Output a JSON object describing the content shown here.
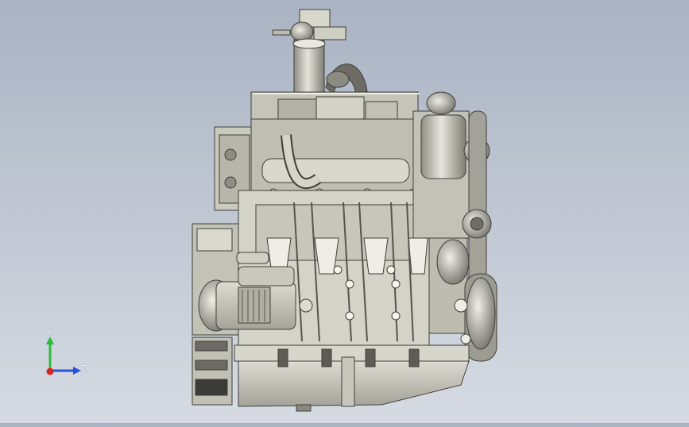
{
  "window": {
    "title": ""
  },
  "viewport": {
    "background_top": "#a9b3c3",
    "background_bottom": "#d6dbe3",
    "model": "engine-assembly-side-view",
    "model_colors": {
      "body": "#c9c8bd",
      "body_dark": "#8f8e84",
      "edge": "#3f3f3a",
      "highlight": "#f2f1e9"
    }
  },
  "triad": {
    "y_label": "Y",
    "z_label": "Z",
    "y_color": "#2dbb3a",
    "z_color": "#2a52d6",
    "x_color": "#d7242b"
  }
}
